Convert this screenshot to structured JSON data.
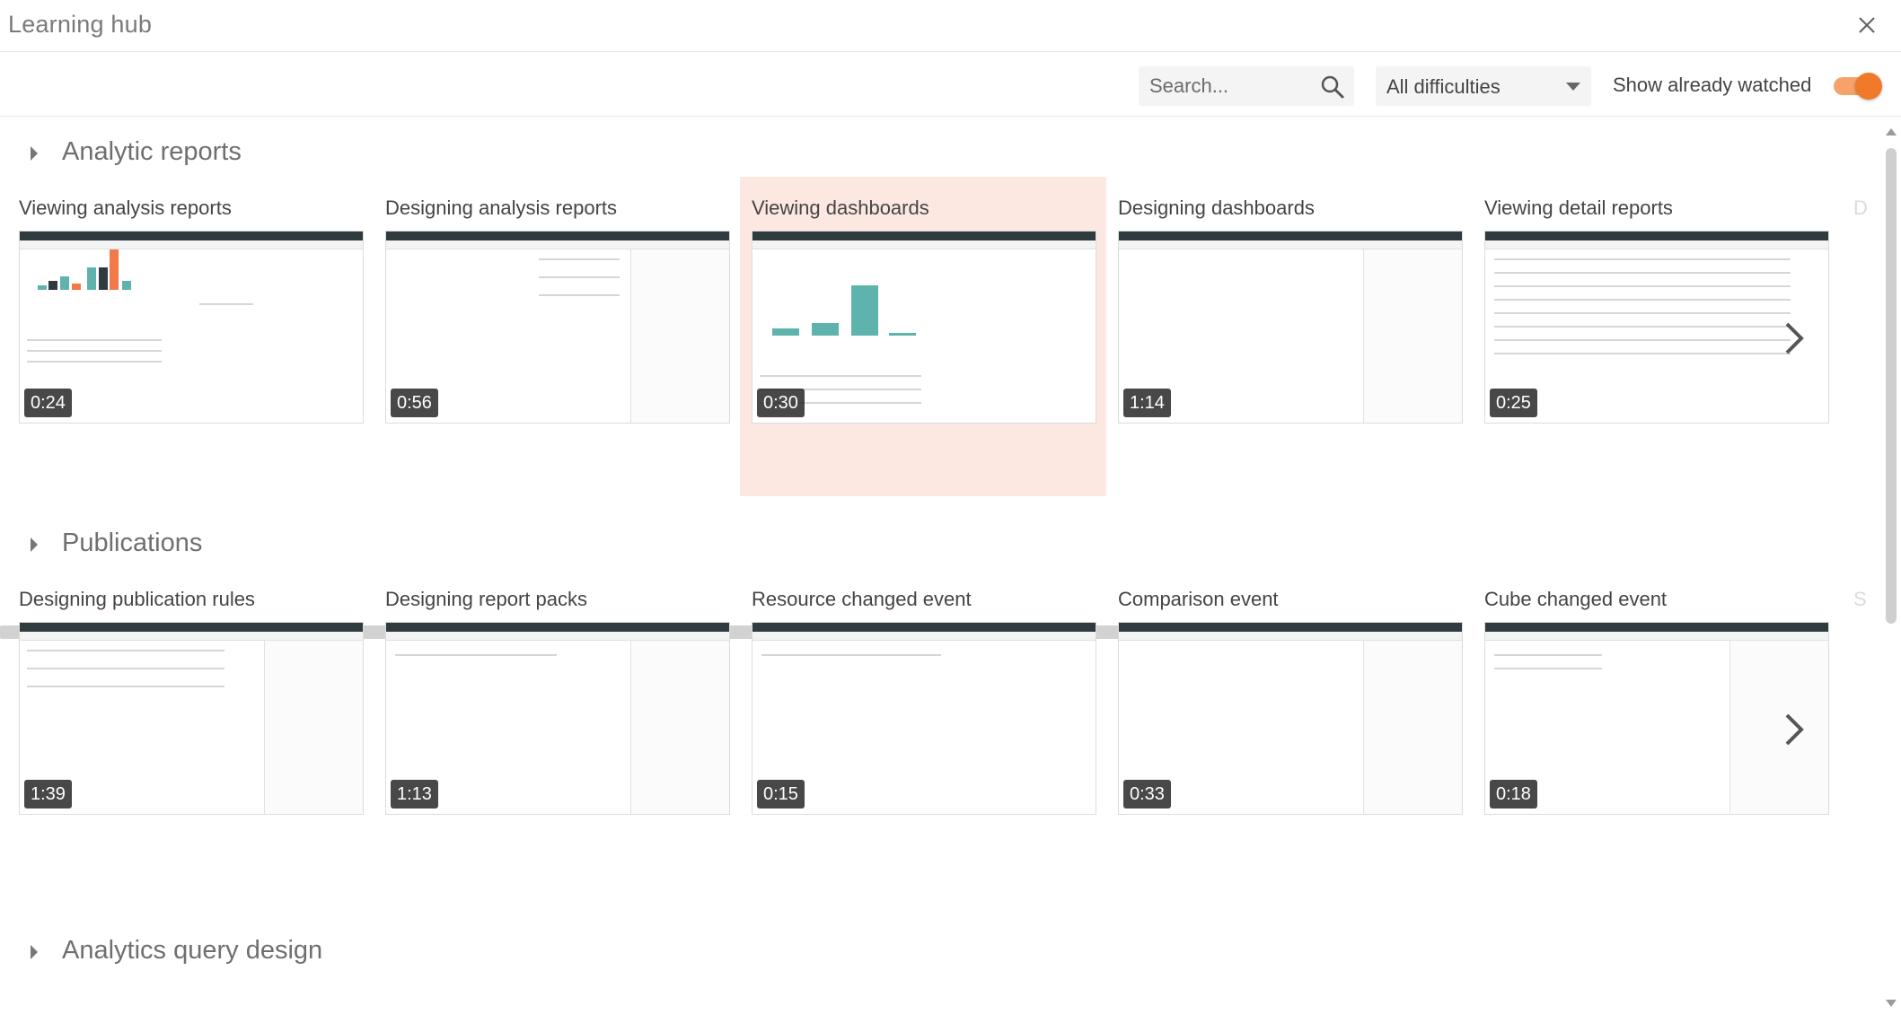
{
  "window": {
    "title": "Learning hub",
    "close_icon": "close-icon"
  },
  "toolbar": {
    "search_placeholder": "Search...",
    "search_icon": "search-icon",
    "difficulty_selected": "All difficulties",
    "show_watched_label": "Show already watched",
    "show_watched_on": true,
    "accent_color": "#f07a2a"
  },
  "sections": [
    {
      "title": "Analytic reports",
      "videos": [
        {
          "title": "Viewing analysis reports",
          "duration": "0:24",
          "highlighted": false
        },
        {
          "title": "Designing analysis reports",
          "duration": "0:56",
          "highlighted": false
        },
        {
          "title": "Viewing dashboards",
          "duration": "0:30",
          "highlighted": true
        },
        {
          "title": "Designing dashboards",
          "duration": "1:14",
          "highlighted": false
        },
        {
          "title": "Viewing detail reports",
          "duration": "0:25",
          "highlighted": false
        }
      ],
      "peek_label": "D"
    },
    {
      "title": "Publications",
      "videos": [
        {
          "title": "Designing publication rules",
          "duration": "1:39",
          "highlighted": false
        },
        {
          "title": "Designing report packs",
          "duration": "1:13",
          "highlighted": false
        },
        {
          "title": "Resource changed event",
          "duration": "0:15",
          "highlighted": false
        },
        {
          "title": "Comparison event",
          "duration": "0:33",
          "highlighted": false
        },
        {
          "title": "Cube changed event",
          "duration": "0:18",
          "highlighted": false
        }
      ],
      "peek_label": "S"
    },
    {
      "title": "Analytics query design",
      "videos": []
    }
  ],
  "colors": {
    "highlight_bg": "#fce8e0",
    "chart_teal": "#5fb3ad",
    "chart_orange": "#f07a4a"
  }
}
